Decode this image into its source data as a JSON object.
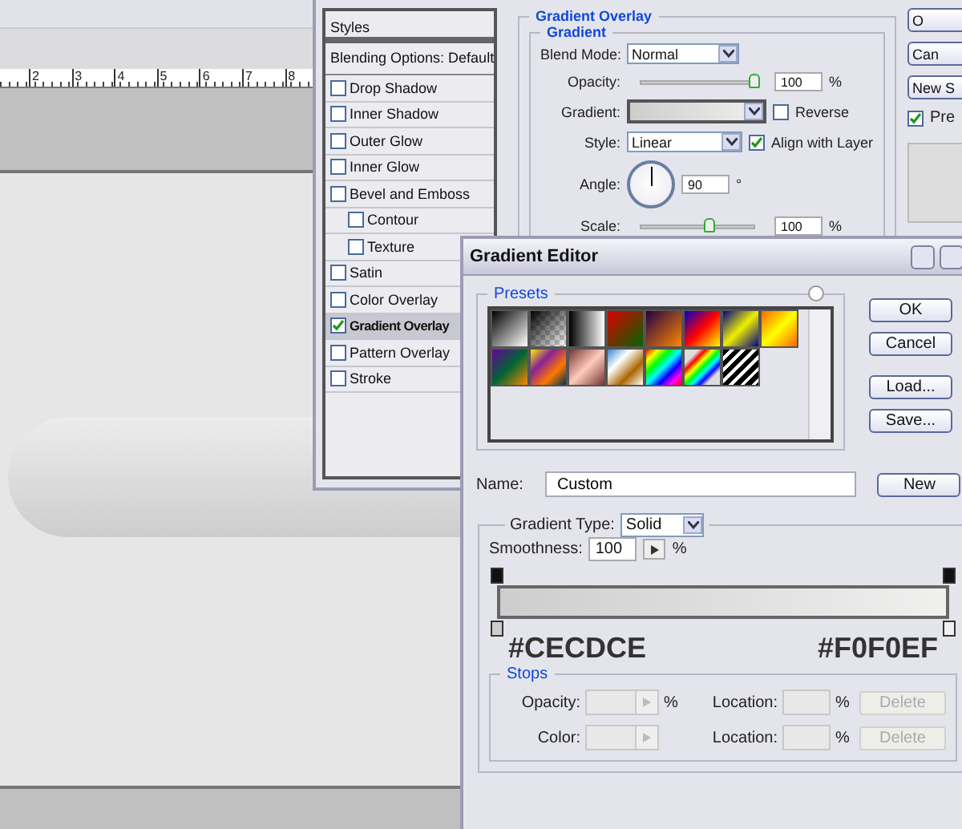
{
  "ruler": {
    "labels": [
      "2",
      "3",
      "4",
      "5",
      "6",
      "7",
      "8"
    ]
  },
  "layer_style": {
    "styles_header": "Styles",
    "blending_options": "Blending Options: Default",
    "effects": [
      {
        "label": "Drop Shadow",
        "checked": false,
        "selected": false
      },
      {
        "label": "Inner Shadow",
        "checked": false,
        "selected": false
      },
      {
        "label": "Outer Glow",
        "checked": false,
        "selected": false
      },
      {
        "label": "Inner Glow",
        "checked": false,
        "selected": false
      },
      {
        "label": "Bevel and Emboss",
        "checked": false,
        "selected": false,
        "children": [
          {
            "label": "Contour",
            "checked": false,
            "selected": false
          },
          {
            "label": "Texture",
            "checked": false,
            "selected": false
          }
        ]
      },
      {
        "label": "Satin",
        "checked": false,
        "selected": false
      },
      {
        "label": "Color Overlay",
        "checked": false,
        "selected": false
      },
      {
        "label": "Gradient Overlay",
        "checked": true,
        "selected": true
      },
      {
        "label": "Pattern Overlay",
        "checked": false,
        "selected": false
      },
      {
        "label": "Stroke",
        "checked": false,
        "selected": false
      }
    ],
    "gradient_overlay": {
      "title": "Gradient Overlay",
      "group": "Gradient",
      "blend_mode": {
        "label": "Blend Mode:",
        "value": "Normal"
      },
      "opacity": {
        "label": "Opacity:",
        "level": 1,
        "value": "100",
        "unit": "%"
      },
      "gradient": {
        "label": "Gradient:"
      },
      "reverse": {
        "label": "Reverse",
        "checked": false
      },
      "style": {
        "label": "Style:",
        "value": "Linear"
      },
      "align": {
        "label": "Align with Layer",
        "checked": true
      },
      "angle": {
        "label": "Angle:",
        "value": "90",
        "unit": "°"
      },
      "scale": {
        "label": "Scale:",
        "level": 0.6,
        "value": "100",
        "unit": "%"
      }
    },
    "buttons": [
      "O",
      "Can",
      "New S"
    ],
    "preview": {
      "label": "Pre",
      "checked": true
    }
  },
  "gradient_editor": {
    "title": "Gradient Editor",
    "presets_label": "Presets",
    "buttons": [
      "OK",
      "Cancel",
      "Load...",
      "Save..."
    ],
    "name": {
      "label": "Name:",
      "value": "Custom"
    },
    "new_button": "New",
    "gradient_type": {
      "label": "Gradient Type:",
      "value": "Solid"
    },
    "smoothness": {
      "label": "Smoothness:",
      "value": "100",
      "unit": "%"
    },
    "stops": [
      {
        "color": "#cecdce",
        "caption": "#CECDCE"
      },
      {
        "color": "#f0f0ef",
        "caption": "#F0F0EF"
      }
    ],
    "stops_group": {
      "title": "Stops",
      "rows": [
        {
          "label": "Opacity:",
          "unit": "%",
          "location_label": "Location:",
          "location_unit": "%",
          "delete": "Delete",
          "disabled": true
        },
        {
          "label": "Color:",
          "location_label": "Location:",
          "location_unit": "%",
          "delete": "Delete",
          "disabled": true
        }
      ]
    }
  }
}
